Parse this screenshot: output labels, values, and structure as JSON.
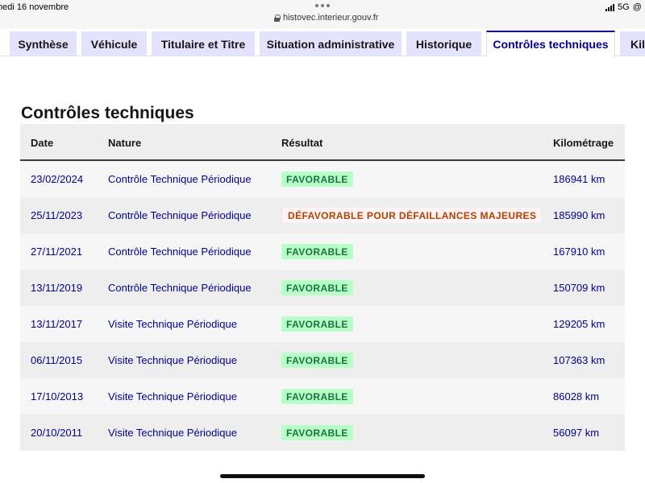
{
  "status_bar": {
    "date": "medi 16 novembre",
    "url": "histovec.interieur.gouv.fr",
    "network": "5G",
    "at": "@",
    "battery_partial": "2"
  },
  "tabs": [
    {
      "label": "Synthèse",
      "active": false
    },
    {
      "label": "Véhicule",
      "active": false
    },
    {
      "label": "Titulaire et Titre",
      "active": false
    },
    {
      "label": "Situation administrative",
      "active": false
    },
    {
      "label": "Historique",
      "active": false
    },
    {
      "label": "Contrôles techniques",
      "active": true
    },
    {
      "label": "Kilo",
      "active": false
    }
  ],
  "section_title": "Contrôles techniques",
  "table": {
    "headers": {
      "date": "Date",
      "nature": "Nature",
      "result": "Résultat",
      "km": "Kilométrage"
    },
    "rows": [
      {
        "date": "23/02/2024",
        "nature": "Contrôle Technique Périodique",
        "result": "FAVORABLE",
        "status": "ok",
        "km": "186941 km"
      },
      {
        "date": "25/11/2023",
        "nature": "Contrôle Technique Périodique",
        "result": "DÉFAVORABLE POUR DÉFAILLANCES MAJEURES",
        "status": "ko",
        "km": "185990 km"
      },
      {
        "date": "27/11/2021",
        "nature": "Contrôle Technique Périodique",
        "result": "FAVORABLE",
        "status": "ok",
        "km": "167910 km"
      },
      {
        "date": "13/11/2019",
        "nature": "Contrôle Technique Périodique",
        "result": "FAVORABLE",
        "status": "ok",
        "km": "150709 km"
      },
      {
        "date": "13/11/2017",
        "nature": "Visite Technique Périodique",
        "result": "FAVORABLE",
        "status": "ok",
        "km": "129205 km"
      },
      {
        "date": "06/11/2015",
        "nature": "Visite Technique Périodique",
        "result": "FAVORABLE",
        "status": "ok",
        "km": "107363 km"
      },
      {
        "date": "17/10/2013",
        "nature": "Visite Technique Périodique",
        "result": "FAVORABLE",
        "status": "ok",
        "km": "86028 km"
      },
      {
        "date": "20/10/2011",
        "nature": "Visite Technique Périodique",
        "result": "FAVORABLE",
        "status": "ok",
        "km": "56097 km"
      }
    ]
  },
  "colors": {
    "accent": "#000091",
    "favorable_bg": "#b8fec9",
    "favorable_text": "#18753c",
    "defavorable_bg": "#fff4f3",
    "defavorable_text": "#b34000",
    "tab_bg": "#e3e3fd"
  }
}
